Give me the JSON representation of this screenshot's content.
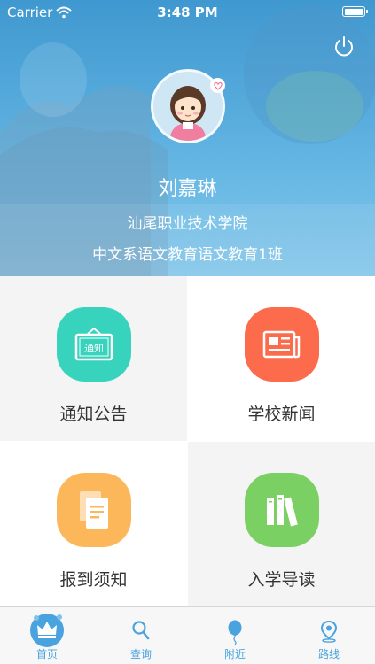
{
  "status_bar": {
    "carrier": "Carrier",
    "time": "3:48 PM",
    "battery_level": 1.0
  },
  "profile": {
    "name": "刘嘉琳",
    "school": "汕尾职业技术学院",
    "class": "中文系语文教育语文教育1班"
  },
  "menu": [
    {
      "label": "通知公告",
      "icon": "notice-board-icon",
      "icon_text": "通知",
      "color": "#37d3bd"
    },
    {
      "label": "学校新闻",
      "icon": "newspaper-icon",
      "color": "#fb6b4c"
    },
    {
      "label": "报到须知",
      "icon": "document-icon",
      "color": "#fcb75a"
    },
    {
      "label": "入学导读",
      "icon": "books-icon",
      "color": "#7bd064"
    }
  ],
  "tabs": [
    {
      "label": "首页",
      "icon": "home-crown-icon",
      "active": true
    },
    {
      "label": "查询",
      "icon": "search-icon"
    },
    {
      "label": "附近",
      "icon": "balloon-icon"
    },
    {
      "label": "路线",
      "icon": "location-pin-icon"
    }
  ],
  "colors": {
    "header_blue": "#4aa3df",
    "tab_active": "#4aa3df"
  }
}
